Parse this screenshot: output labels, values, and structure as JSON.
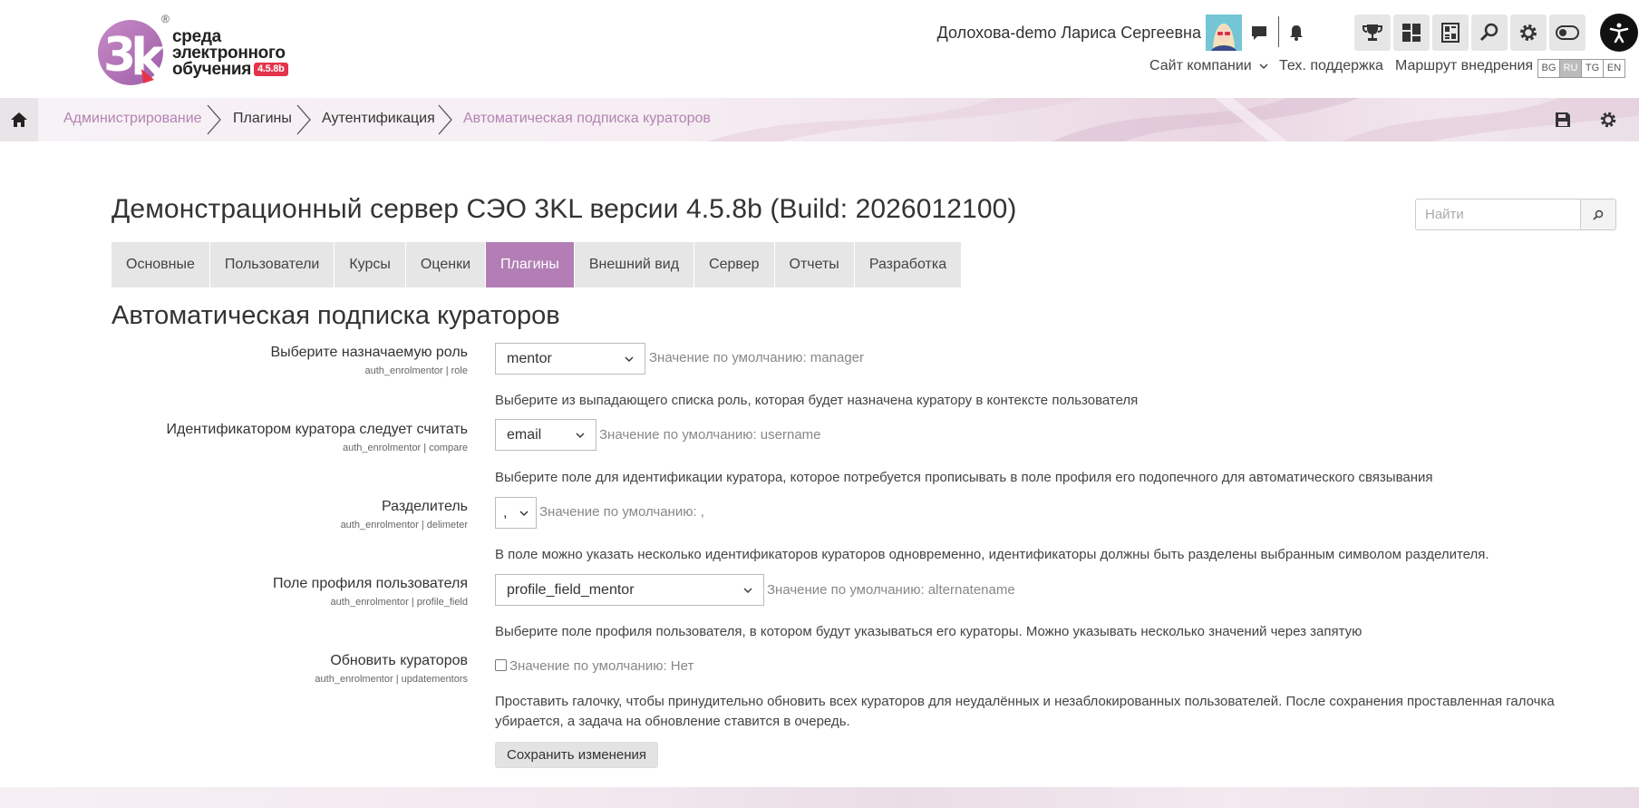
{
  "logo": {
    "line1": "среда",
    "line2": "электронного",
    "line3": "обучения",
    "version": "4.5.8b",
    "registered": "®"
  },
  "header": {
    "user_name": "Долохова-demo Лариса Сергеевна",
    "icons": [
      "chat-icon",
      "bell-icon",
      "trophy-icon",
      "dashboard-icon",
      "catalog-icon",
      "search-icon",
      "gear-icon",
      "toggle-icon",
      "accessibility-icon"
    ],
    "links": {
      "company_site": "Сайт компании",
      "support": "Тех. поддержка",
      "route": "Маршрут внедрения"
    },
    "languages": [
      "BG",
      "RU",
      "TG",
      "EN"
    ],
    "active_language": "RU"
  },
  "breadcrumb": {
    "items": [
      "Администрирование",
      "Плагины",
      "Аутентификация",
      "Автоматическая подписка кураторов"
    ]
  },
  "page": {
    "title": "Демонстрационный сервер СЭО 3KL версии 4.5.8b (Build: 2026012100)",
    "search_placeholder": "Найти",
    "tabs": [
      "Основные",
      "Пользователи",
      "Курсы",
      "Оценки",
      "Плагины",
      "Внешний вид",
      "Сервер",
      "Отчеты",
      "Разработка"
    ],
    "active_tab": "Плагины",
    "section_title": "Автоматическая подписка кураторов"
  },
  "settings": [
    {
      "label": "Выберите назначаемую роль",
      "key": "auth_enrolmentor | role",
      "value": "mentor",
      "default": "Значение по умолчанию: manager",
      "description": "Выберите из выпадающего списка роль, которая будет назначена куратору в контексте пользователя"
    },
    {
      "label": "Идентификатором куратора следует считать",
      "key": "auth_enrolmentor | compare",
      "value": "email",
      "default": "Значение по умолчанию: username",
      "description": "Выберите поле для идентификации куратора, которое потребуется прописывать в поле профиля его подопечного для автоматического связывания"
    },
    {
      "label": "Разделитель",
      "key": "auth_enrolmentor | delimeter",
      "value": ",",
      "default": "Значение по умолчанию: ,",
      "description": "В поле можно указать несколько идентификаторов кураторов одновременно, идентификаторы должны быть разделены выбранным символом разделителя."
    },
    {
      "label": "Поле профиля пользователя",
      "key": "auth_enrolmentor | profile_field",
      "value": "profile_field_mentor",
      "default": "Значение по умолчанию: alternatename",
      "description": "Выберите поле профиля пользователя, в котором будут указываться его кураторы. Можно указывать несколько значений через запятую"
    },
    {
      "label": "Обновить кураторов",
      "key": "auth_enrolmentor | updatementors",
      "checked": false,
      "default": "Значение по умолчанию: Нет",
      "description_line1": "Проставить галочку, чтобы принудительно обновить всех кураторов для неудалённых и незаблокированных пользователей. После сохранения проставленная галочка",
      "description_line2": "убирается, а задача на обновление ставится в очередь."
    }
  ],
  "save_button": "Сохранить изменения",
  "colors": {
    "accent": "#b27eb5",
    "breadcrumb_link": "#b383b3",
    "version_badge": "#e5334b"
  }
}
